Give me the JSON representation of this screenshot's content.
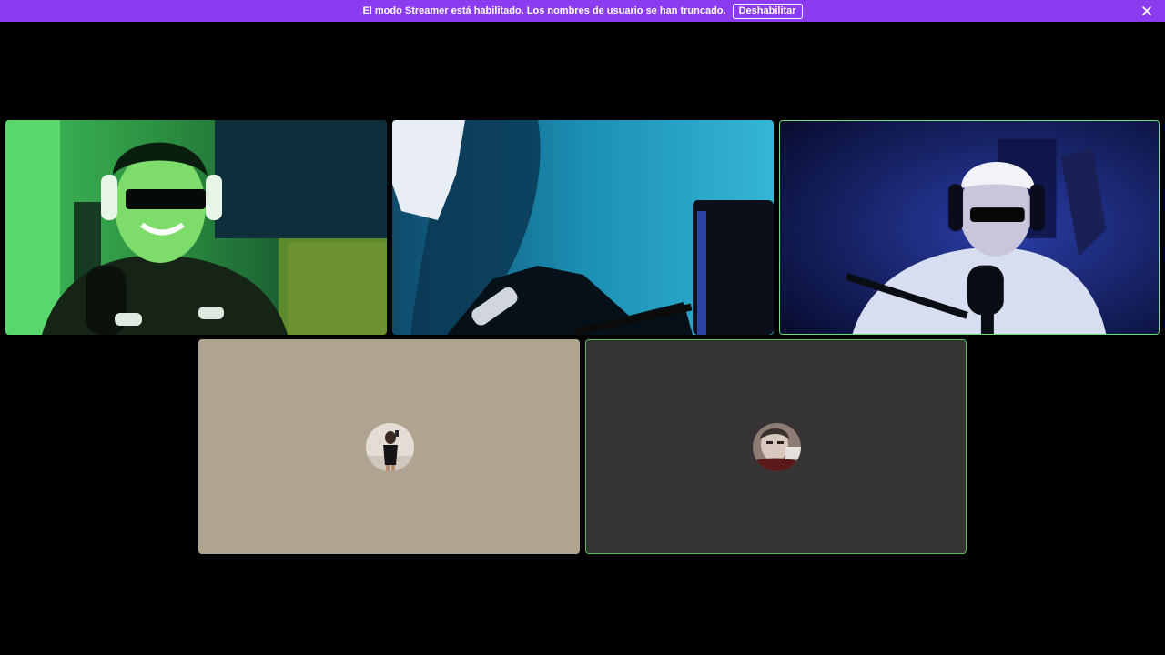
{
  "banner": {
    "message": "El modo Streamer está habilitado. Los nombres de usuario se han truncado.",
    "disable_label": "Deshabilitar",
    "background": "#8c3cf0"
  },
  "colors": {
    "speaking_ring": "#43b581",
    "tile_4_bg": "#b0a490",
    "tile_5_bg": "#353333"
  },
  "tiles": [
    {
      "type": "camera"
    },
    {
      "type": "camera"
    },
    {
      "type": "camera",
      "speaking": true
    },
    {
      "type": "avatar"
    },
    {
      "type": "avatar",
      "speaking": true
    }
  ],
  "icons": {
    "close": "close-icon"
  }
}
